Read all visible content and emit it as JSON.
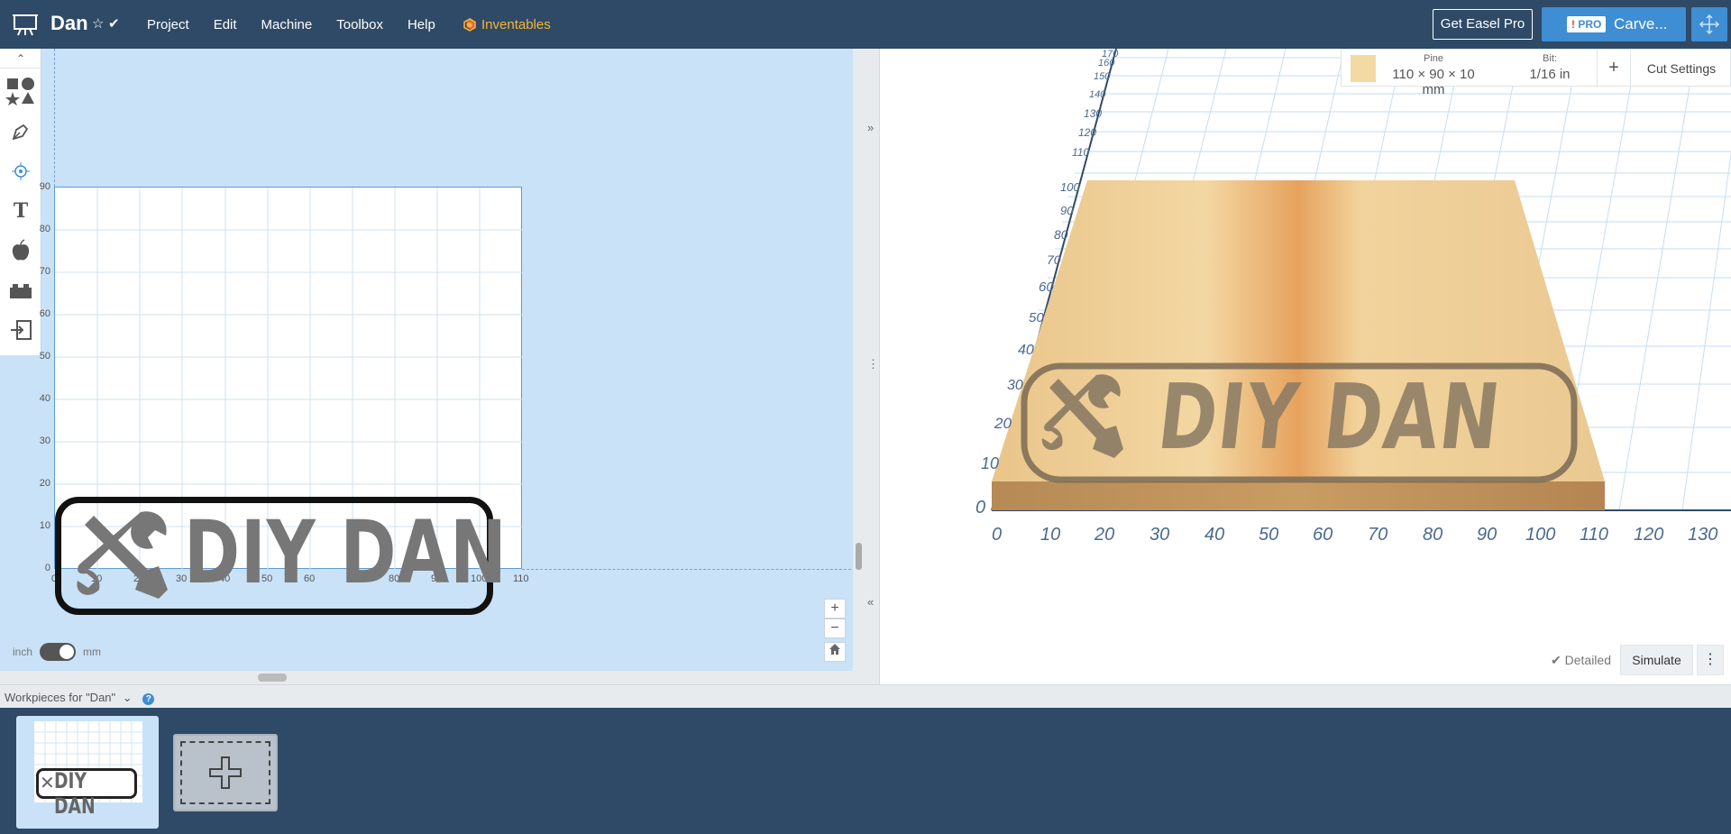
{
  "header": {
    "project_title": "Dan",
    "menu": [
      "Project",
      "Edit",
      "Machine",
      "Toolbox",
      "Help"
    ],
    "inventables_label": "Inventables",
    "get_pro_label": "Get Easel Pro",
    "pro_badge": "PRO",
    "carve_label": "Carve...",
    "accent_color": "#3f8dd3",
    "bar_color": "#2f4a66"
  },
  "design": {
    "y_ticks": [
      "90",
      "80",
      "70",
      "60",
      "50",
      "40",
      "30",
      "20",
      "10",
      "0"
    ],
    "x_ticks": [
      "0",
      "10",
      "20",
      "30",
      "40",
      "50",
      "60",
      "70",
      "80",
      "90",
      "100",
      "110"
    ],
    "logo_text": "DIY DAN",
    "unit_left": "inch",
    "unit_right": "mm",
    "zoom_in": "+",
    "zoom_out": "−"
  },
  "preview": {
    "material_name": "Pine",
    "material_size": "110 × 90 × 10 mm",
    "bit_label": "Bit:",
    "bit_value": "1/16 in",
    "add_label": "+",
    "cut_settings_label": "Cut Settings",
    "detailed_label": "Detailed",
    "simulate_label": "Simulate",
    "more_label": "⋮",
    "x_axis_ticks": [
      "0",
      "10",
      "20",
      "30",
      "40",
      "50",
      "60",
      "70",
      "80",
      "90",
      "100",
      "110",
      "120",
      "130"
    ],
    "y_axis_ticks_back": [
      "170",
      "160",
      "150",
      "140",
      "130",
      "120",
      "110",
      "100",
      "90",
      "80",
      "70",
      "60",
      "50",
      "40",
      "30",
      "20",
      "10",
      "0"
    ],
    "logo_text": "DIY DAN"
  },
  "workpieces": {
    "header_label": "Workpieces for \"Dan\"",
    "help_label": "?",
    "thumb_text": "DIY DAN"
  }
}
